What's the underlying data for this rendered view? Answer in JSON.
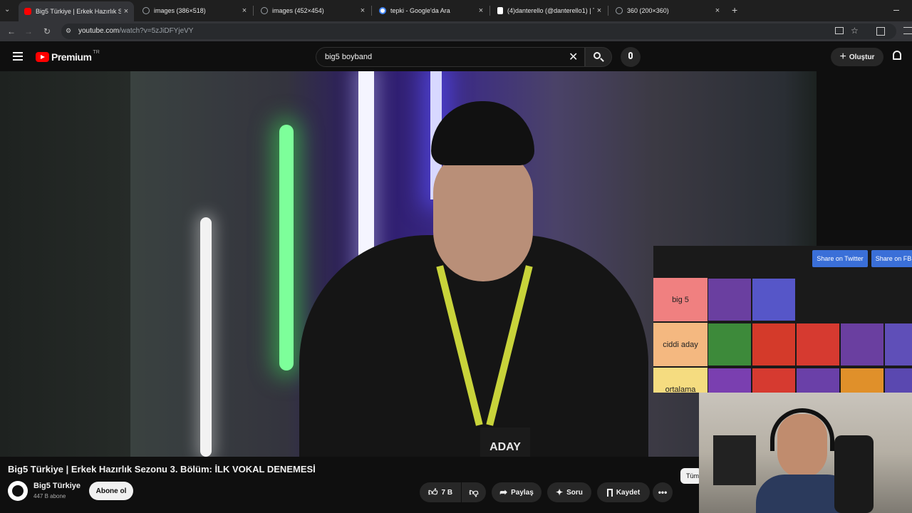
{
  "browser": {
    "tabs": [
      {
        "title": "Big5 Türkiye | Erkek Hazırlık Se…",
        "favicon_color": "#ff0000",
        "active": true
      },
      {
        "title": "images (386×518)",
        "favicon_color": "#9aa0a6",
        "active": false
      },
      {
        "title": "images (452×454)",
        "favicon_color": "#9aa0a6",
        "active": false
      },
      {
        "title": "tepki - Google'da Ara",
        "favicon_color": "#4285f4",
        "active": false
      },
      {
        "title": "(4)danterello (@danterello1) | T…",
        "favicon_color": "#ffffff",
        "active": false
      },
      {
        "title": "360 (200×360)",
        "favicon_color": "#9aa0a6",
        "active": false
      }
    ],
    "new_tab_label": "+",
    "url_host": "youtube.com",
    "url_path": "/watch?v=5zJiDFYjeVY"
  },
  "youtube": {
    "logo_text": "Premium",
    "region_badge": "TR",
    "search_value": "big5 boyband",
    "create_label": "Oluştur"
  },
  "video": {
    "title": "Big5 Türkiye | Erkek Hazırlık Sezonu 3. Bölüm: İLK VOKAL DENEMESİ",
    "badge_text": "ADAY",
    "channel": {
      "name": "Big5 Türkiye",
      "subscribers": "447 B abone",
      "subscribe_label": "Abone ol"
    },
    "actions": {
      "likes": "7 B",
      "share": "Paylaş",
      "ask": "Soru",
      "save": "Kaydet"
    },
    "chip_partial": "Tüm"
  },
  "tierlist": {
    "share_twitter": "Share on Twitter",
    "share_fb": "Share on FB",
    "tiers": [
      {
        "label": "big 5",
        "color": "#f08080",
        "count": 2
      },
      {
        "label": "ciddi aday",
        "color": "#f4b880",
        "count": 5
      },
      {
        "label": "ortalama",
        "color": "#f5dc80",
        "count": 5
      }
    ]
  },
  "colors": {
    "accent_red": "#ff0000",
    "link_blue": "#3a6fd8"
  }
}
